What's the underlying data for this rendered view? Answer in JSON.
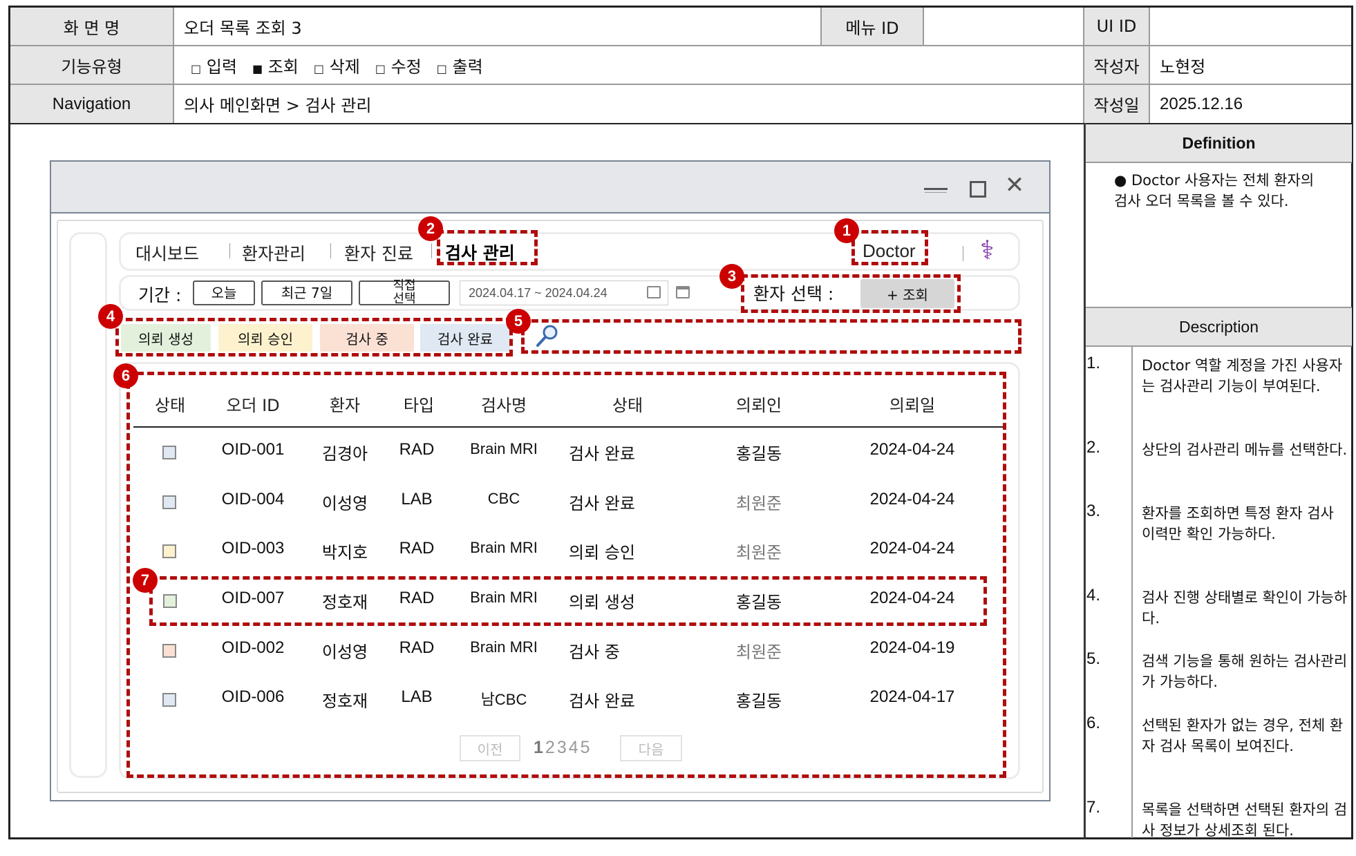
{
  "header": {
    "screen_name_label": "화 면 명",
    "screen_name": "오더 목록 조회 3",
    "menu_id_label": "메뉴 ID",
    "menu_id": "",
    "ui_id_label": "UI ID",
    "ui_id": "",
    "func_type_label": "기능유형",
    "func_types": [
      {
        "mark": "□",
        "label": "입력"
      },
      {
        "mark": "■",
        "label": "조회"
      },
      {
        "mark": "□",
        "label": "삭제"
      },
      {
        "mark": "□",
        "label": "수정"
      },
      {
        "mark": "□",
        "label": "출력"
      }
    ],
    "author_label": "작성자",
    "author": "노현정",
    "nav_label": "Navigation",
    "nav_path": "의사 메인화면 > 검사 관리",
    "date_label": "작성일",
    "date": "2025.12.16"
  },
  "app": {
    "window_controls": {
      "minimize": "—",
      "maximize": "☐",
      "close": "✕"
    },
    "nav_items": [
      "대시보드",
      "환자관리",
      "환자 진료",
      "검사 관리"
    ],
    "role_label": "Doctor",
    "caduceus": "⚕",
    "period_label": "기간 :",
    "period_buttons": [
      "오늘",
      "최근 7일",
      "직접\n선택"
    ],
    "date_range": "2024.04.17 ~ 2024.04.24",
    "patient_select_label": "환자 선택 :",
    "lookup_button": "+ 조회",
    "status_chips": [
      {
        "label": "의뢰 생성",
        "color": "#e3f1dc"
      },
      {
        "label": "의뢰 승인",
        "color": "#fdf2cd"
      },
      {
        "label": "검사 중",
        "color": "#fbe1d4"
      },
      {
        "label": "검사 완료",
        "color": "#dfe8f3"
      }
    ],
    "search_icon": "search-icon",
    "table": {
      "headers": [
        "상태",
        "오더 ID",
        "환자",
        "타입",
        "검사명",
        "상태",
        "의뢰인",
        "의뢰일"
      ],
      "rows": [
        {
          "color": "#dfe8f3",
          "order_id": "OID-001",
          "patient": "김경아",
          "type": "RAD",
          "exam": "Brain MRI",
          "status": "검사 완료",
          "requester": "홍길동",
          "date": "2024-04-24"
        },
        {
          "color": "#dfe8f3",
          "order_id": "OID-004",
          "patient": "이성영",
          "type": "LAB",
          "exam": "CBC",
          "status": "검사 완료",
          "requester": "최원준",
          "date": "2024-04-24"
        },
        {
          "color": "#fdf2cd",
          "order_id": "OID-003",
          "patient": "박지호",
          "type": "RAD",
          "exam": "Brain MRI",
          "status": "의뢰 승인",
          "requester": "최원준",
          "date": "2024-04-24"
        },
        {
          "color": "#e3f1dc",
          "order_id": "OID-007",
          "patient": "정호재",
          "type": "RAD",
          "exam": "Brain MRI",
          "status": "의뢰 생성",
          "requester": "홍길동",
          "date": "2024-04-24"
        },
        {
          "color": "#fbe1d4",
          "order_id": "OID-002",
          "patient": "이성영",
          "type": "RAD",
          "exam": "Brain MRI",
          "status": "검사 중",
          "requester": "최원준",
          "date": "2024-04-19"
        },
        {
          "color": "#dfe8f3",
          "order_id": "OID-006",
          "patient": "정호재",
          "type": "LAB",
          "exam": "남CBC",
          "status": "검사 완료",
          "requester": "홍길동",
          "date": "2024-04-17"
        }
      ]
    },
    "pagination": {
      "prev": "이전",
      "pages": [
        "1",
        "2",
        "3",
        "4",
        "5"
      ],
      "next": "다음"
    },
    "badges": [
      "1",
      "2",
      "3",
      "4",
      "5",
      "6",
      "7"
    ]
  },
  "right_panel": {
    "definition_title": "Definition",
    "definition_text": "● Doctor 사용자는 전체 환자의 검사 오더 목록을 볼 수 있다.",
    "description_title": "Description",
    "items": [
      {
        "num": "1.",
        "text": "Doctor 역할 계정을 가진 사용자는 검사관리 기능이 부여된다."
      },
      {
        "num": "2.",
        "text": "상단의 검사관리 메뉴를 선택한다."
      },
      {
        "num": "3.",
        "text": "환자를 조회하면 특정 환자 검사 이력만 확인 가능하다."
      },
      {
        "num": "4.",
        "text": "검사 진행 상태별로 확인이 가능하다."
      },
      {
        "num": "5.",
        "text": "검색 기능을 통해 원하는 검사관리가 가능하다."
      },
      {
        "num": "6.",
        "text": "선택된 환자가 없는 경우, 전체 환자 검사 목록이 보여진다."
      },
      {
        "num": "7.",
        "text": "목록을 선택하면 선택된 환자의 검사 정보가 상세조회 된다."
      }
    ]
  }
}
